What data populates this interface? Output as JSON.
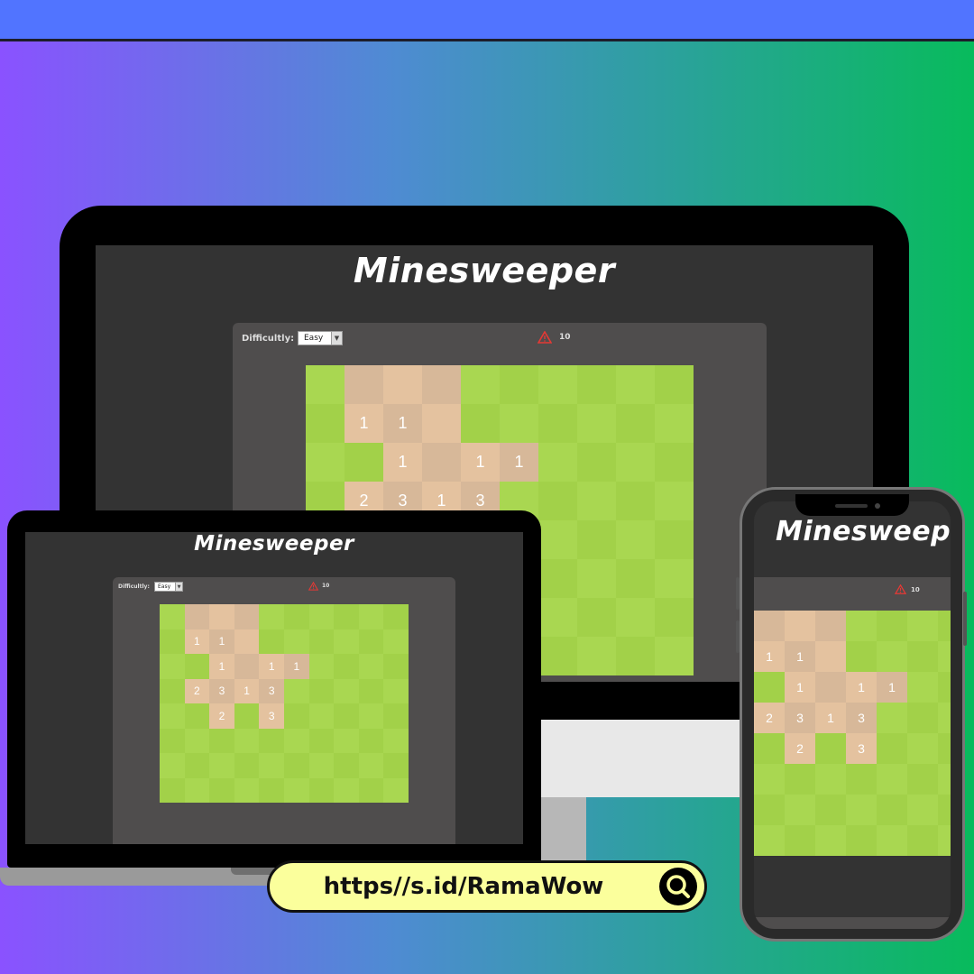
{
  "app": {
    "title": "Minesweeper",
    "difficulty_label": "Difficultly:",
    "difficulty_value": "Easy",
    "mine_count": "10",
    "mine_icon": "warning-triangle-icon"
  },
  "board": {
    "cols": 10,
    "rows": 8,
    "cells": [
      [
        null,
        "r",
        "r",
        "r",
        null,
        null,
        null,
        null,
        null,
        null
      ],
      [
        null,
        "1",
        "1",
        "r",
        null,
        null,
        null,
        null,
        null,
        null
      ],
      [
        null,
        null,
        "1",
        "r",
        "1",
        "1",
        null,
        null,
        null,
        null
      ],
      [
        null,
        "2",
        "3",
        "1",
        "3",
        null,
        null,
        null,
        null,
        null
      ],
      [
        null,
        null,
        "2",
        null,
        "3",
        null,
        null,
        null,
        null,
        null
      ],
      [
        null,
        null,
        null,
        null,
        null,
        null,
        null,
        null,
        null,
        null
      ],
      [
        null,
        null,
        null,
        null,
        null,
        null,
        null,
        null,
        null,
        null
      ],
      [
        null,
        null,
        null,
        null,
        null,
        null,
        null,
        null,
        null,
        null
      ]
    ]
  },
  "promo": {
    "url": "https//s.id/RamaWow",
    "search_icon": "search-icon"
  },
  "colors": {
    "grass_light": "#a9d751",
    "grass_dark": "#a2d149",
    "revealed_light": "#e4c29f",
    "revealed_dark": "#d7b899",
    "panel": "#4f4d4d",
    "screen": "#333333",
    "warning": "#e53935"
  }
}
